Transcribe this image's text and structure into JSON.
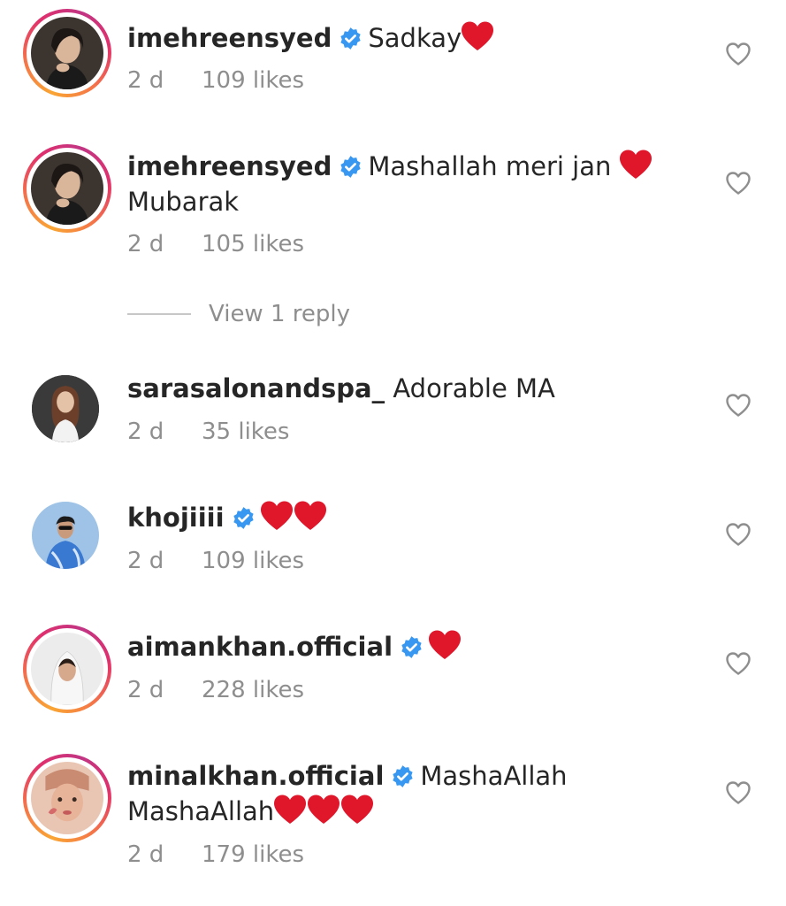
{
  "comments": [
    {
      "username": "imehreensyed",
      "verified": true,
      "text": "Sadkay",
      "hearts": 1,
      "time": "2 d",
      "likes": "109 likes"
    },
    {
      "username": "imehreensyed",
      "verified": true,
      "text": "Mashallah meri jan",
      "hearts": 1,
      "text_line2": "Mubarak",
      "time": "2 d",
      "likes": "105 likes",
      "view_replies": "View 1 reply"
    },
    {
      "username": "sarasalonandspa_",
      "verified": false,
      "text": "Adorable MA",
      "hearts": 0,
      "time": "2 d",
      "likes": "35 likes"
    },
    {
      "username": "khojiiii",
      "verified": true,
      "text": "",
      "hearts": 2,
      "time": "2 d",
      "likes": "109 likes"
    },
    {
      "username": "aimankhan.official",
      "verified": true,
      "text": "",
      "hearts": 1,
      "time": "2 d",
      "likes": "228 likes"
    },
    {
      "username": "minalkhan.official",
      "verified": true,
      "text": "MashaAllah",
      "hearts": 0,
      "text_line2": "MashaAllah",
      "hearts_line2": 3,
      "time": "2 d",
      "likes": "179 likes"
    }
  ],
  "colors": {
    "text": "#262626",
    "meta": "#8e8e8e",
    "verified": "#3897f0",
    "heart": "#e0162b"
  },
  "icons": {
    "like": "heart-outline-icon",
    "verified": "verified-badge-icon",
    "emoji": "red-heart-emoji"
  }
}
